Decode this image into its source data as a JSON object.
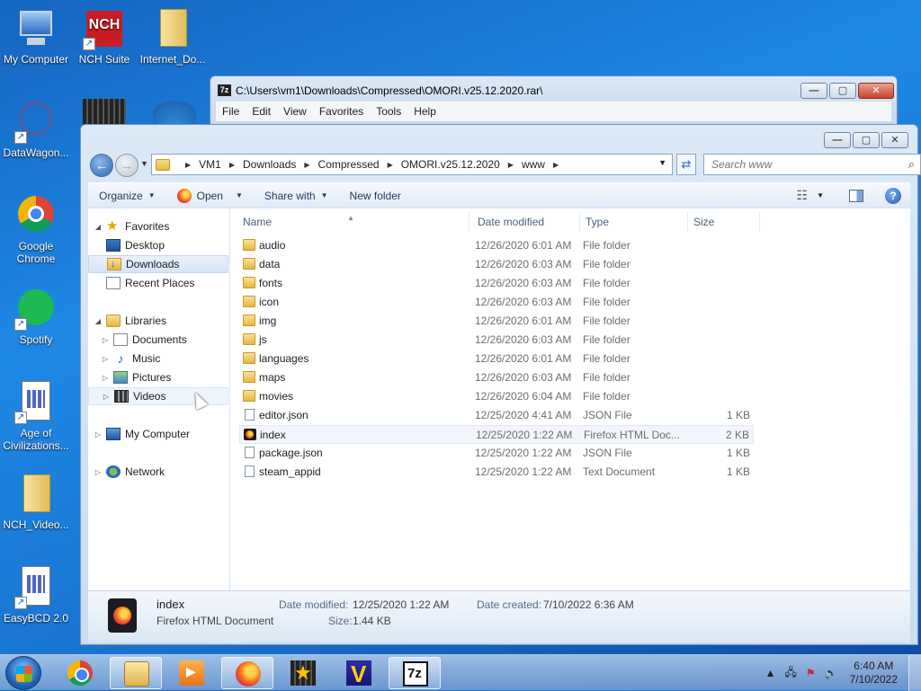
{
  "desktop": {
    "icons": [
      {
        "label": "My Computer",
        "icon": "computer-icon"
      },
      {
        "label": "NCH Suite",
        "icon": "nch-suite-icon"
      },
      {
        "label": "Internet_Do...",
        "icon": "folder-icon"
      },
      {
        "label": "DataWagon...",
        "icon": "datawagon-icon"
      },
      {
        "label": "Google Chrome",
        "icon": "chrome-icon"
      },
      {
        "label": "Spotify",
        "icon": "spotify-icon"
      },
      {
        "label": "Age of Civilizations...",
        "icon": "document-icon"
      },
      {
        "label": "NCH_Video...",
        "icon": "folder-icon"
      },
      {
        "label": "EasyBCD 2.0",
        "icon": "document-icon"
      }
    ]
  },
  "window_7z": {
    "title": "C:\\Users\\vm1\\Downloads\\Compressed\\OMORI.v25.12.2020.rar\\",
    "app_icon_text": "7z",
    "menu": [
      "File",
      "Edit",
      "View",
      "Favorites",
      "Tools",
      "Help"
    ]
  },
  "caption": {
    "minimize": "—",
    "maximize": "▢",
    "close": "✕"
  },
  "explorer": {
    "breadcrumbs": [
      "VM1",
      "Downloads",
      "Compressed",
      "OMORI.v25.12.2020",
      "www"
    ],
    "search_placeholder": "Search www",
    "toolbar": {
      "organize": "Organize",
      "open": "Open",
      "share_with": "Share with",
      "new_folder": "New folder"
    },
    "nav": {
      "favorites": "Favorites",
      "desktop": "Desktop",
      "downloads": "Downloads",
      "recent_places": "Recent Places",
      "libraries": "Libraries",
      "documents": "Documents",
      "music": "Music",
      "pictures": "Pictures",
      "videos": "Videos",
      "my_computer": "My Computer",
      "network": "Network"
    },
    "columns": {
      "name": "Name",
      "date": "Date modified",
      "type": "Type",
      "size": "Size"
    },
    "files": [
      {
        "name": "audio",
        "date": "12/26/2020 6:01 AM",
        "type": "File folder",
        "size": "",
        "kind": "folder"
      },
      {
        "name": "data",
        "date": "12/26/2020 6:03 AM",
        "type": "File folder",
        "size": "",
        "kind": "folder"
      },
      {
        "name": "fonts",
        "date": "12/26/2020 6:03 AM",
        "type": "File folder",
        "size": "",
        "kind": "folder"
      },
      {
        "name": "icon",
        "date": "12/26/2020 6:03 AM",
        "type": "File folder",
        "size": "",
        "kind": "folder"
      },
      {
        "name": "img",
        "date": "12/26/2020 6:01 AM",
        "type": "File folder",
        "size": "",
        "kind": "folder"
      },
      {
        "name": "js",
        "date": "12/26/2020 6:03 AM",
        "type": "File folder",
        "size": "",
        "kind": "folder"
      },
      {
        "name": "languages",
        "date": "12/26/2020 6:01 AM",
        "type": "File folder",
        "size": "",
        "kind": "folder"
      },
      {
        "name": "maps",
        "date": "12/26/2020 6:03 AM",
        "type": "File folder",
        "size": "",
        "kind": "folder"
      },
      {
        "name": "movies",
        "date": "12/26/2020 6:04 AM",
        "type": "File folder",
        "size": "",
        "kind": "folder"
      },
      {
        "name": "editor.json",
        "date": "12/25/2020 4:41 AM",
        "type": "JSON File",
        "size": "1 KB",
        "kind": "file"
      },
      {
        "name": "index",
        "date": "12/25/2020 1:22 AM",
        "type": "Firefox HTML Doc...",
        "size": "2 KB",
        "kind": "html"
      },
      {
        "name": "package.json",
        "date": "12/25/2020 1:22 AM",
        "type": "JSON File",
        "size": "1 KB",
        "kind": "file"
      },
      {
        "name": "steam_appid",
        "date": "12/25/2020 1:22 AM",
        "type": "Text Document",
        "size": "1 KB",
        "kind": "file"
      }
    ],
    "details": {
      "name": "index",
      "type": "Firefox HTML Document",
      "modified_label": "Date modified:",
      "modified_value": "12/25/2020 1:22 AM",
      "created_label": "Date created:",
      "created_value": "7/10/2022 6:36 AM",
      "size_label": "Size:",
      "size_value": "1.44 KB"
    }
  },
  "taskbar": {
    "apps": [
      "chrome-icon",
      "explorer-icon",
      "media-player-icon",
      "firefox-icon",
      "video-editor-icon",
      "vegas-icon",
      "7zip-icon"
    ],
    "clock_time": "6:40 AM",
    "clock_date": "7/10/2022"
  }
}
